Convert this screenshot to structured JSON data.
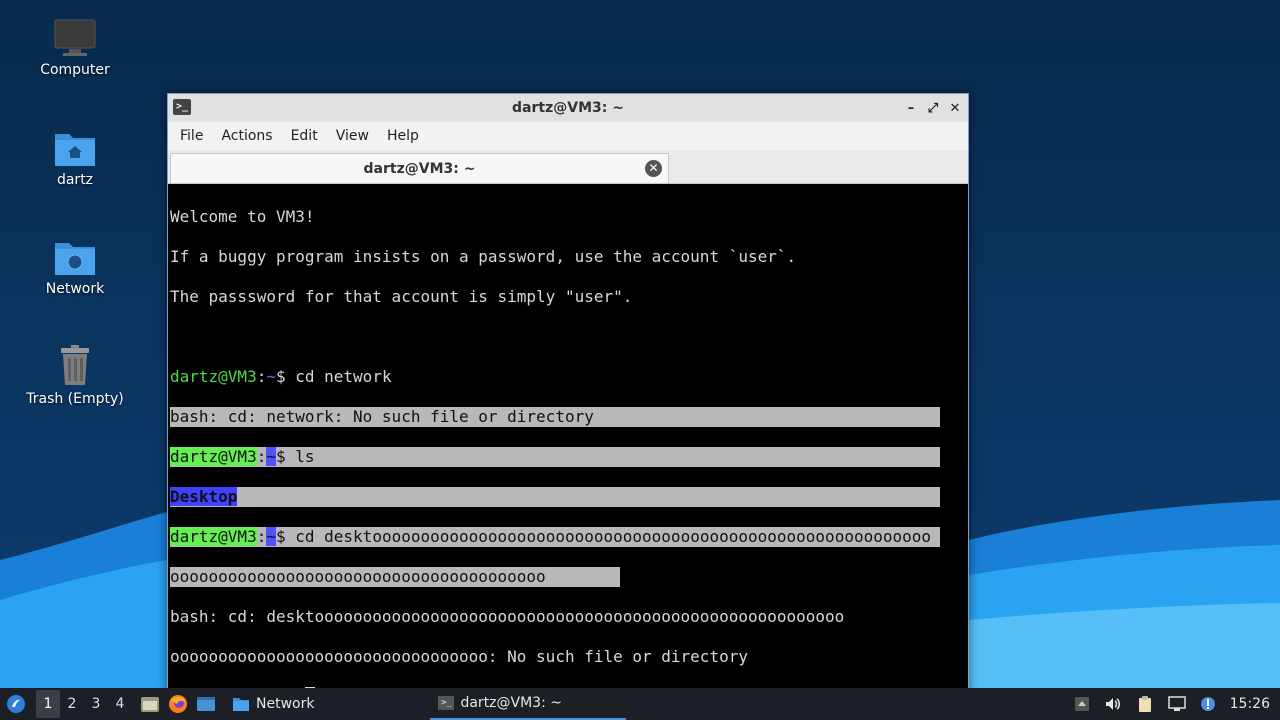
{
  "desktop": {
    "icons": [
      {
        "label": "Computer",
        "icon": "computer-icon"
      },
      {
        "label": "dartz",
        "icon": "home-folder-icon"
      },
      {
        "label": "Network",
        "icon": "network-folder-icon"
      },
      {
        "label": "Trash (Empty)",
        "icon": "trash-icon"
      }
    ]
  },
  "window": {
    "title": "dartz@VM3: ~",
    "menu": [
      "File",
      "Actions",
      "Edit",
      "View",
      "Help"
    ],
    "tab_title": "dartz@VM3: ~",
    "controls": {
      "minimize": "–",
      "maximize": "⤢",
      "close": "✕"
    }
  },
  "terminal": {
    "prompt_user": "dartz@VM3",
    "prompt_sep": ":",
    "prompt_path": "~",
    "prompt_dollar": "$ ",
    "lines": {
      "welcome1": "Welcome to VM3!",
      "welcome2": "If a buggy program insists on a password, use the account `user`.",
      "welcome3": "The passsword for that account is simply \"user\".",
      "cmd1": "cd network",
      "err1": "bash: cd: network: No such file or directory",
      "cmd2": "ls",
      "dir1": "Desktop",
      "cmd3a": "cd desktoooooooooooooooooooooooooooooooooooooooooooooooooooooooooo",
      "cmd3b": "ooooooooooooooooooooooooooooooooooooooo",
      "err2a": "bash: cd: desktooooooooooooooooooooooooooooooooooooooooooooooooooooooo",
      "err2b": "ooooooooooooooooooooooooooooooooo: No such file or directory",
      "cmd4": "c"
    }
  },
  "taskbar": {
    "workspaces": [
      "1",
      "2",
      "3",
      "4"
    ],
    "active_workspace": "1",
    "tasks": [
      {
        "label": "Network",
        "icon": "folder-icon"
      },
      {
        "label": "dartz@VM3: ~",
        "icon": "terminal-icon"
      }
    ],
    "clock": "15:26"
  },
  "colors": {
    "prompt_green": "#4cdb4c",
    "prompt_blue": "#6a6aff",
    "selection": "#b8b8b8",
    "taskbar": "#1c1f26"
  }
}
